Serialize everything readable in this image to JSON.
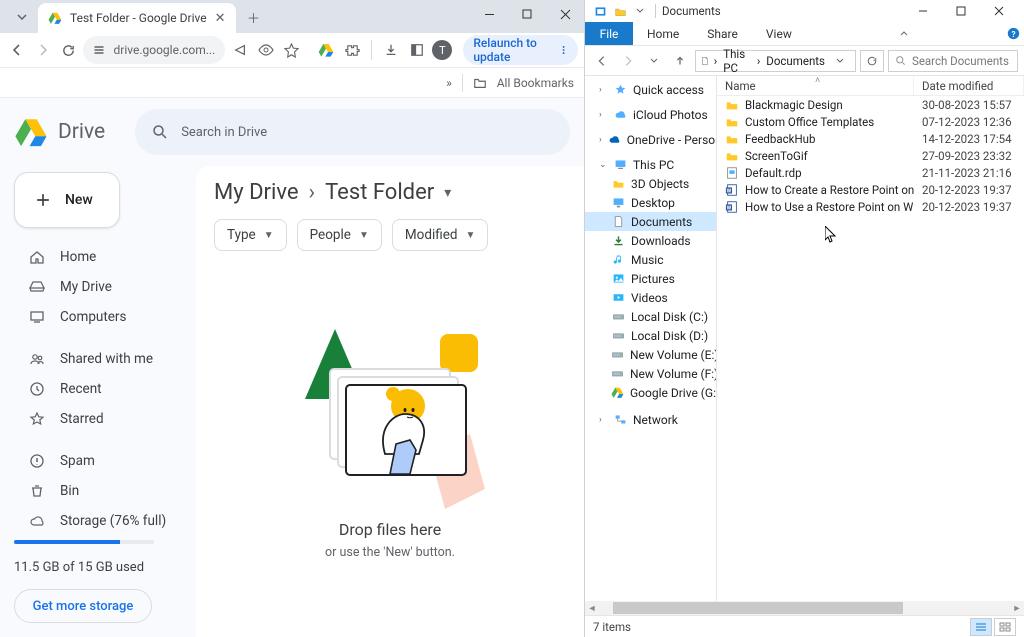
{
  "chrome": {
    "tab": {
      "title": "Test Folder - Google Drive",
      "favicon": "drive"
    },
    "omnibox_url": "drive.google.com...",
    "relaunch_label": "Relaunch to update",
    "all_bookmarks_label": "All Bookmarks"
  },
  "drive": {
    "brand": "Drive",
    "search_placeholder": "Search in Drive",
    "new_button": "New",
    "path": {
      "root": "My Drive",
      "current": "Test Folder"
    },
    "chips": {
      "type": "Type",
      "people": "People",
      "modified": "Modified"
    },
    "nav": {
      "home": "Home",
      "mydrive": "My Drive",
      "computers": "Computers",
      "shared": "Shared with me",
      "recent": "Recent",
      "starred": "Starred",
      "spam": "Spam",
      "bin": "Bin",
      "storage": "Storage (76% full)"
    },
    "storage_pct": 76,
    "used_line": "11.5 GB of 15 GB used",
    "get_more": "Get more storage",
    "drop_title": "Drop files here",
    "drop_sub": "or use the 'New' button."
  },
  "explorer": {
    "title": "Documents",
    "tabs": {
      "file": "File",
      "home": "Home",
      "share": "Share",
      "view": "View"
    },
    "nav": {
      "thispc": "This PC",
      "documents": "Documents"
    },
    "refresh_icon": "refresh",
    "search_placeholder": "Search Documents",
    "tree": [
      {
        "icon": "star",
        "label": "Quick access",
        "indent": false
      },
      {
        "icon": "cloud",
        "label": "iCloud Photos",
        "indent": false
      },
      {
        "icon": "onedrive",
        "label": "OneDrive - Personal",
        "indent": false
      },
      {
        "icon": "pc",
        "label": "This PC",
        "indent": false,
        "expanded": true
      },
      {
        "icon": "folder",
        "label": "3D Objects",
        "indent": true
      },
      {
        "icon": "desktop",
        "label": "Desktop",
        "indent": true
      },
      {
        "icon": "docs",
        "label": "Documents",
        "indent": true,
        "selected": true
      },
      {
        "icon": "down",
        "label": "Downloads",
        "indent": true
      },
      {
        "icon": "music",
        "label": "Music",
        "indent": true
      },
      {
        "icon": "pic",
        "label": "Pictures",
        "indent": true
      },
      {
        "icon": "video",
        "label": "Videos",
        "indent": true
      },
      {
        "icon": "disk",
        "label": "Local Disk (C:)",
        "indent": true
      },
      {
        "icon": "disk",
        "label": "Local Disk (D:)",
        "indent": true
      },
      {
        "icon": "disk",
        "label": "New Volume (E:)",
        "indent": true
      },
      {
        "icon": "disk",
        "label": "New Volume (F:)",
        "indent": true
      },
      {
        "icon": "gdrive",
        "label": "Google Drive (G:)",
        "indent": true
      },
      {
        "icon": "net",
        "label": "Network",
        "indent": false
      }
    ],
    "columns": {
      "name": "Name",
      "date": "Date modified"
    },
    "files": [
      {
        "icon": "folder",
        "name": "Blackmagic Design",
        "date": "30-08-2023 15:57"
      },
      {
        "icon": "folder",
        "name": "Custom Office Templates",
        "date": "07-12-2023 12:36"
      },
      {
        "icon": "folder",
        "name": "FeedbackHub",
        "date": "14-12-2023 17:54"
      },
      {
        "icon": "folder",
        "name": "ScreenToGif",
        "date": "27-09-2023 23:32"
      },
      {
        "icon": "rdp",
        "name": "Default.rdp",
        "date": "21-11-2023 21:16"
      },
      {
        "icon": "docx",
        "name": "How to Create a Restore Point on Windo...",
        "date": "20-12-2023 19:37"
      },
      {
        "icon": "docx",
        "name": "How to Use a Restore Point on Windows ...",
        "date": "20-12-2023 19:37"
      }
    ],
    "status": "7 items"
  }
}
